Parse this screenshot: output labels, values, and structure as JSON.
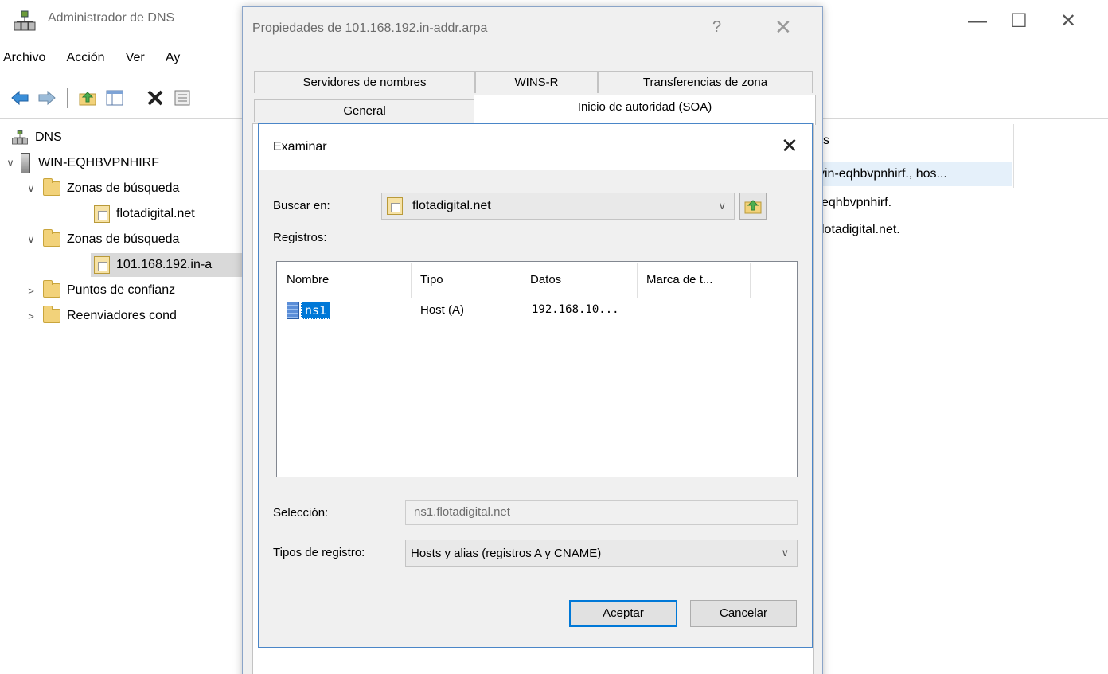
{
  "app": {
    "title": "Administrador de DNS",
    "controls": {
      "minimize": "—",
      "maximize": "☐",
      "close": "✕"
    }
  },
  "menu": [
    "Archivo",
    "Acción",
    "Ver",
    "Ay"
  ],
  "toolbar": [
    "back-arrow-icon",
    "forward-arrow-icon",
    "up-folder-icon",
    "show-hide-tree-icon",
    "delete-icon",
    "properties-icon"
  ],
  "tree": {
    "root": "DNS",
    "server": "WIN-EQHBVPNHIRF",
    "forward_zones": "Zonas de búsqueda",
    "forward_zone_item": "flotadigital.net",
    "reverse_zones": "Zonas de búsqueda",
    "reverse_zone_item": "101.168.192.in-a",
    "trust_points": "Puntos de confianz",
    "cond_forwarders": "Reenviadores cond"
  },
  "right_pane": {
    "header_fragment": "s",
    "row1": "vin-eqhbvpnhirf., hos...",
    "row2": "eqhbvpnhirf.",
    "row3": "lotadigital.net."
  },
  "properties": {
    "title": "Propiedades de 101.168.192.in-addr.arpa",
    "help": "?",
    "close": "✕",
    "tabs_back": [
      "Servidores de nombres",
      "WINS-R",
      "Transferencias de zona"
    ],
    "tabs_front": [
      "General",
      "Inicio de autoridad (SOA)"
    ]
  },
  "browse": {
    "title": "Examinar",
    "close": "✕",
    "look_in_label": "Buscar en:",
    "look_in_value": "flotadigital.net",
    "records_label": "Registros:",
    "columns": [
      "Nombre",
      "Tipo",
      "Datos",
      "Marca de t..."
    ],
    "rows": [
      {
        "name": "ns1",
        "type": "Host (A)",
        "data": "192.168.10..."
      }
    ],
    "selection_label": "Selección:",
    "selection_value": "ns1.flotadigital.net",
    "record_types_label": "Tipos de registro:",
    "record_types_value": "Hosts y alias (registros A y CNAME)",
    "ok": "Aceptar",
    "cancel": "Cancelar"
  },
  "colors": {
    "accent": "#0078d7",
    "dialog_border": "#4a86c8",
    "folder": "#f2d27a"
  }
}
